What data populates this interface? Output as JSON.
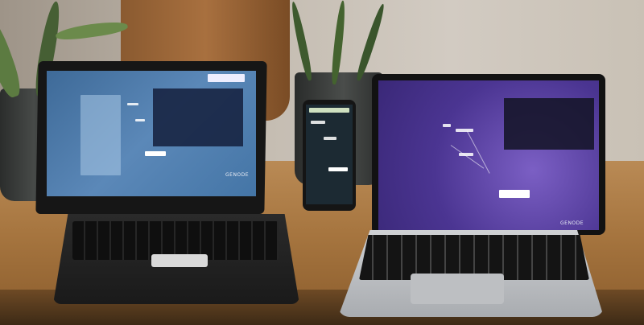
{
  "scene": {
    "left_screen": {
      "brand_label": "GENODE"
    },
    "right_screen": {
      "brand_label": "GENODE"
    }
  }
}
